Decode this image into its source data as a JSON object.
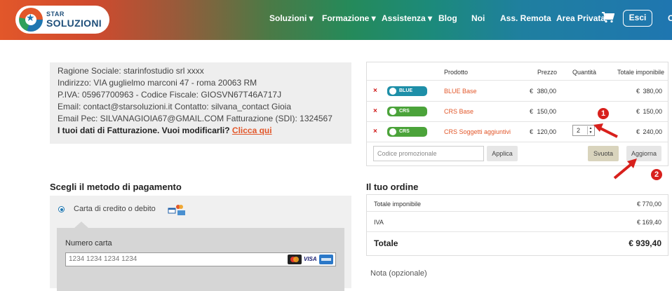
{
  "header": {
    "logo_line1": "STAR",
    "logo_line2": "SOLUZIONI",
    "nav": [
      "Soluzioni ▾",
      "Formazione ▾",
      "Assistenza ▾",
      "Blog",
      "Noi",
      "Ass. Remota",
      "Area Privata"
    ],
    "logout_label": "Esci",
    "overflow_text": "C"
  },
  "billing": {
    "line1": "Ragione Sociale: starinfostudio srl xxxx",
    "line2": "Indirizzo: VIA guglielmo marconi 47 - roma 20063 RM",
    "line3": "P.IVA: 05967700963 - Codice Fiscale: GIOSVN67T46A717J",
    "line4": "Email: contact@starsoluzioni.it Contatto: silvana_contact Gioia",
    "line5": "Email Pec: SILVANAGIOIA67@GMAIL.COM Fatturazione (SDI): 1324567",
    "edit_prompt": "I tuoi dati di Fatturazione. Vuoi modificarli?",
    "edit_link": "Clicca qui"
  },
  "cart": {
    "headers": {
      "product": "Prodotto",
      "price": "Prezzo",
      "quantity": "Quantità",
      "total": "Totale imponibile"
    },
    "items": [
      {
        "badge": "BLUE",
        "name": "BLUE Base",
        "price": "380,00",
        "quantity": "",
        "total": "380,00",
        "badge_color": "#1e8fa8"
      },
      {
        "badge": "CRS",
        "name": "CRS Base",
        "price": "150,00",
        "quantity": "",
        "total": "150,00",
        "badge_color": "#4ba33a"
      },
      {
        "badge": "CRS",
        "name": "CRS Soggetti aggiuntivi",
        "price": "120,00",
        "quantity": "2",
        "total": "240,00",
        "badge_color": "#4ba33a"
      }
    ],
    "currency": "€",
    "remove_icon": "×",
    "promo_placeholder": "Codice promozionale",
    "apply_label": "Applica",
    "empty_label": "Svuota",
    "update_label": "Aggiorna"
  },
  "payment": {
    "title": "Scegli il metodo di pagamento",
    "option_label": "Carta di credito o debito",
    "card_number_label": "Numero carta",
    "card_number_placeholder": "1234 1234 1234 1234",
    "visa_label": "VISA"
  },
  "order": {
    "title": "Il tuo ordine",
    "rows": [
      {
        "label": "Totale imponibile",
        "value": "€ 770,00"
      },
      {
        "label": "IVA",
        "value": "€ 169,40"
      }
    ],
    "total_label": "Totale",
    "total_value": "€ 939,40",
    "note_label": "Nota (opzionale)"
  },
  "annotations": {
    "callout1": "1",
    "callout2": "2"
  },
  "colors": {
    "accent": "#e2572a",
    "callout": "#d8201c",
    "brand_blue": "#1f76b0"
  }
}
